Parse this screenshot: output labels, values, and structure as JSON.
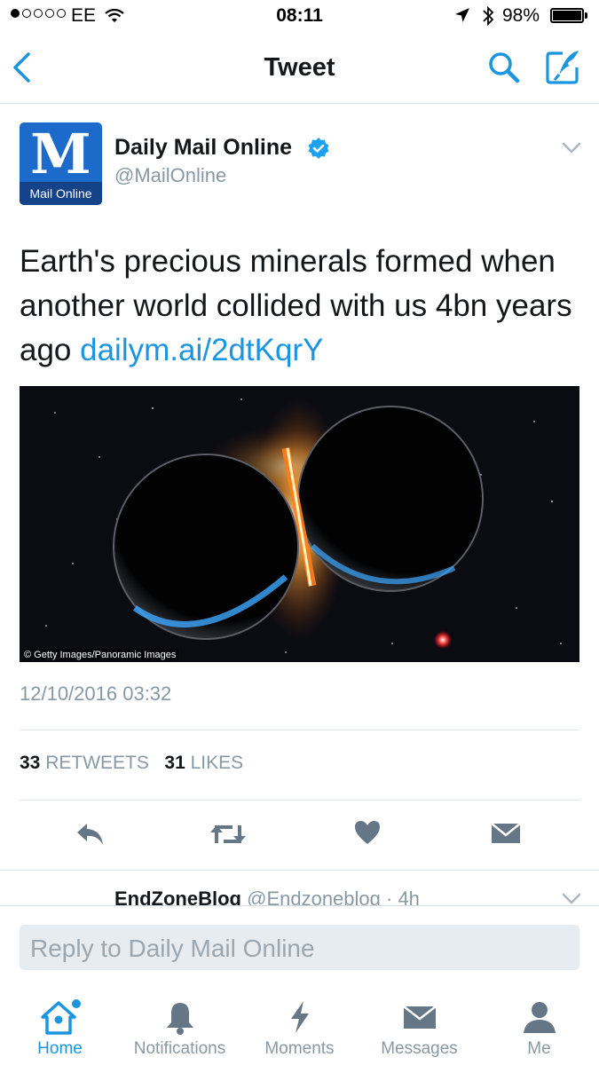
{
  "status_bar": {
    "carrier": "EE",
    "time": "08:11",
    "battery": "98%"
  },
  "nav": {
    "title": "Tweet"
  },
  "tweet": {
    "author_name": "Daily Mail Online",
    "author_handle": "@MailOnline",
    "avatar_text": "M",
    "avatar_subtext": "Mail Online",
    "text_plain": "Earth's precious minerals formed when another world collided with us 4bn years ago ",
    "text_link": "dailym.ai/2dtKqrY",
    "image_credit": "© Getty Images/Panoramic Images",
    "timestamp": "12/10/2016 03:32",
    "retweet_count": "33",
    "retweet_label": "RETWEETS",
    "like_count": "31",
    "like_label": "LIKES"
  },
  "next_tweet": {
    "name": "EndZoneBlog",
    "handle_time": "@Endzoneblog · 4h"
  },
  "reply": {
    "placeholder": "Reply to Daily Mail Online"
  },
  "tabbar": {
    "home": "Home",
    "notifications": "Notifications",
    "moments": "Moments",
    "messages": "Messages",
    "me": "Me"
  },
  "colors": {
    "accent": "#1b95e0",
    "secondary_text": "#8899a6",
    "icon_grey": "#657786"
  }
}
